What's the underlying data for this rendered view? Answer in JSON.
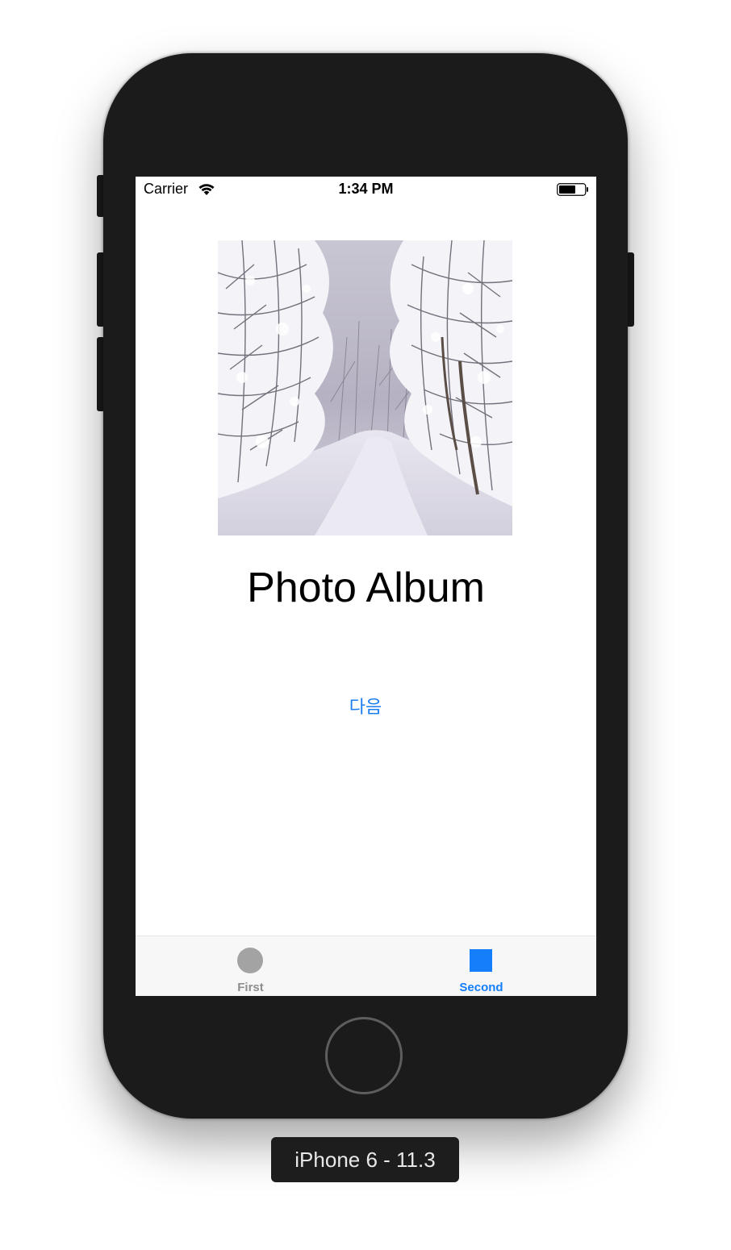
{
  "status_bar": {
    "carrier": "Carrier",
    "time": "1:34 PM",
    "wifi_icon": "wifi-icon",
    "battery_icon": "battery-icon"
  },
  "main": {
    "image_icon": "snowy-forest-path-photo",
    "title": "Photo Album",
    "next_button_label": "다음"
  },
  "tab_bar": {
    "tabs": [
      {
        "label": "First",
        "icon": "circle-icon",
        "selected": false
      },
      {
        "label": "Second",
        "icon": "square-icon",
        "selected": true
      }
    ]
  },
  "device_label": "iPhone 6 - 11.3",
  "colors": {
    "accent": "#147efb",
    "tab_inactive": "#8e8e8e",
    "phone_body": "#1b1b1b"
  }
}
